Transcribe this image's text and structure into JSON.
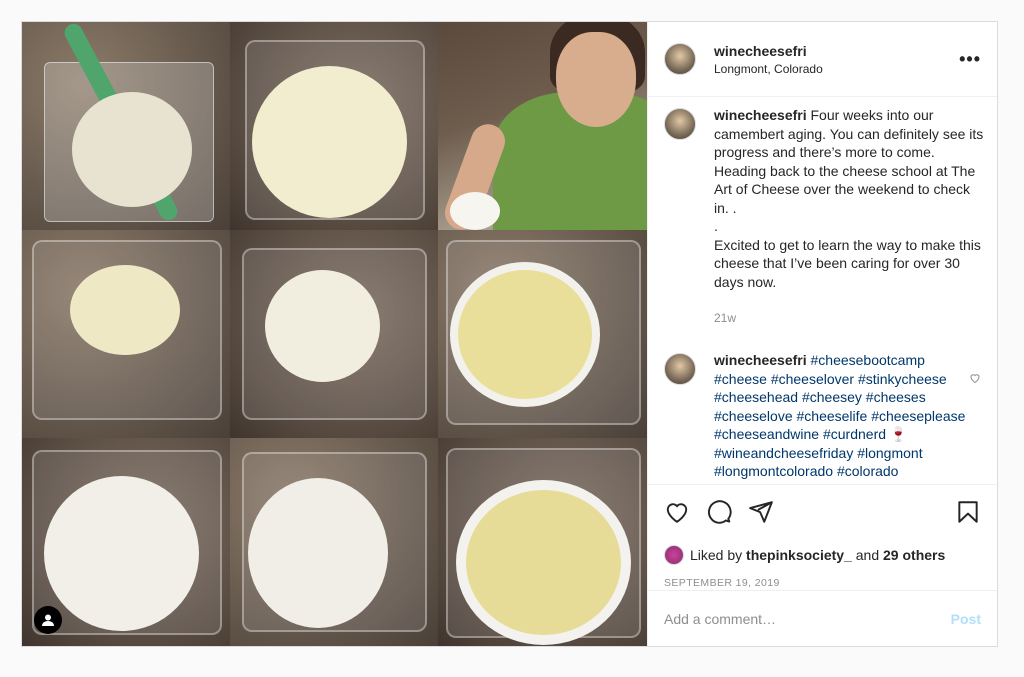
{
  "post": {
    "username": "winecheesefri",
    "location": "Longmont, Colorado",
    "more_label": "•••"
  },
  "caption": {
    "username": "winecheesefri",
    "text_1": "Four weeks into our camembert aging. You can definitely see its progress and there’s more to come. Heading back to the cheese school at The Art of Cheese over the weekend to check in. .",
    "text_2": ".",
    "text_3": "Excited to get to learn the way to make this cheese that I’ve been caring for over 30 days now.",
    "time": "21w"
  },
  "comment": {
    "username": "winecheesefri",
    "hashtags_1": "#cheesebootcamp #cheese #cheeselover #stinkycheese #cheesehead #cheesey #cheeses #cheeselove #cheeselife #cheeseplease #cheeseandwine #curdnerd",
    "emoji": "🍷",
    "hashtags_2": "#wineandcheesefriday #longmont #longmontcolorado #colorado"
  },
  "likes": {
    "prefix": "Liked by",
    "user": "thepinksociety_",
    "and": "and",
    "others": "29 others"
  },
  "date": "SEPTEMBER 19, 2019",
  "add_comment": {
    "placeholder": "Add a comment…",
    "post_label": "Post"
  },
  "icons": [
    "heart-icon",
    "comment-icon",
    "share-icon",
    "bookmark-icon",
    "ellipsis-icon",
    "user-tag-icon"
  ]
}
